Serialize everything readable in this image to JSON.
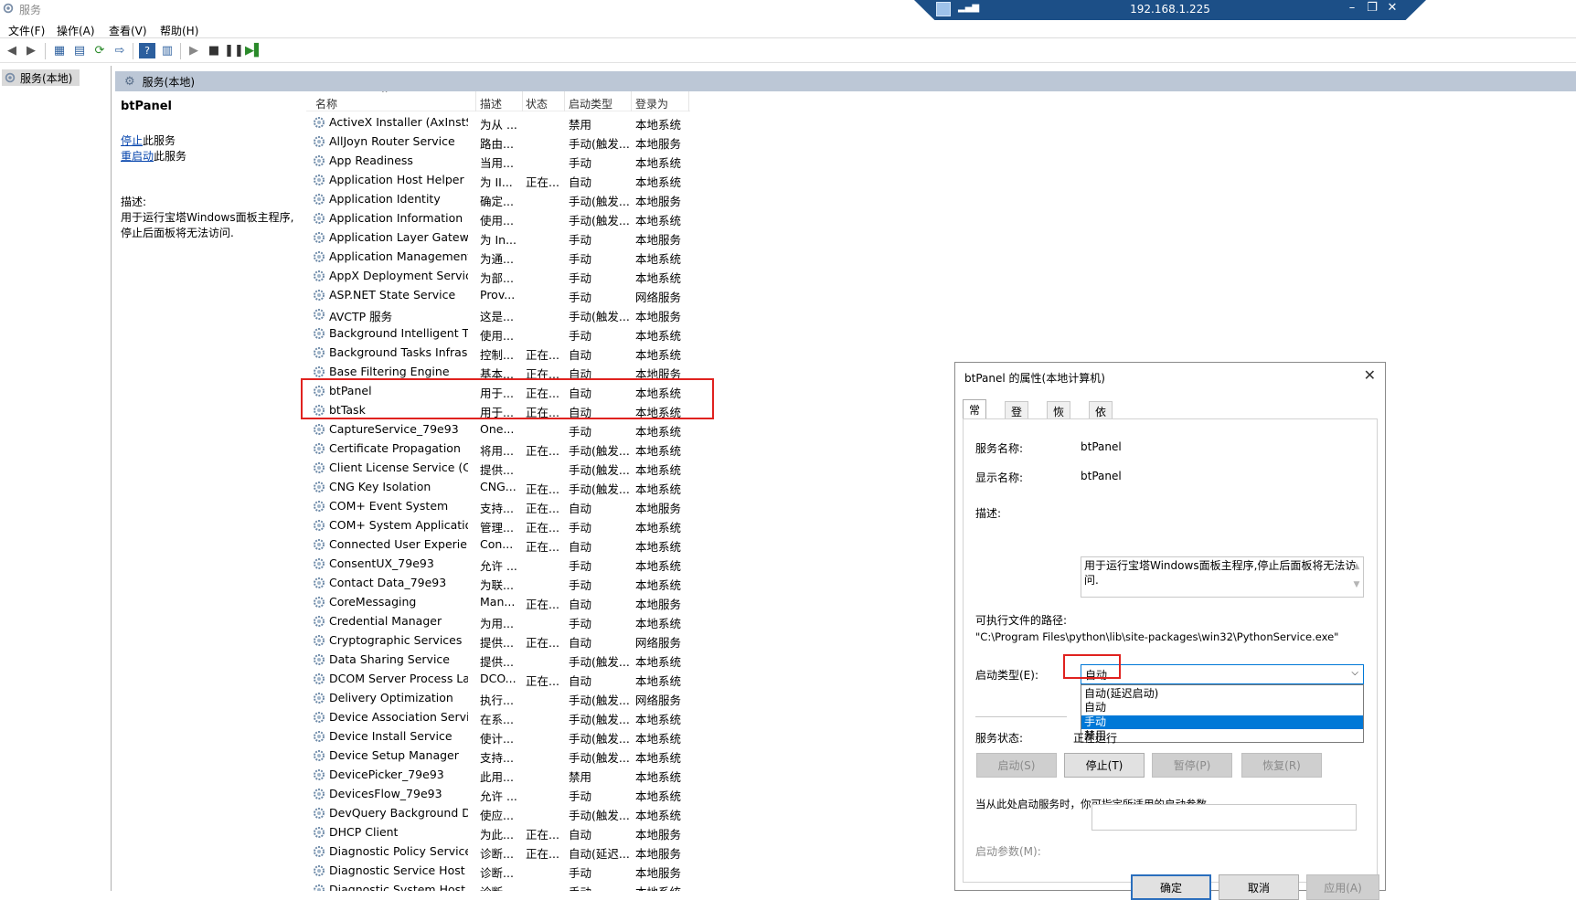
{
  "window": {
    "title": "服务"
  },
  "rdp": {
    "ip": "192.168.1.225",
    "minimize": "–",
    "restore": "❐",
    "close": "✕"
  },
  "menu": [
    "文件(F)",
    "操作(A)",
    "查看(V)",
    "帮助(H)"
  ],
  "tree": {
    "root": "服务(本地)"
  },
  "header": {
    "title": "服务(本地)"
  },
  "detail": {
    "name": "btPanel",
    "stop_link": "停止",
    "stop_suffix": "此服务",
    "restart_link": "重启动",
    "restart_suffix": "此服务",
    "desc_label": "描述:",
    "desc_text": "用于运行宝塔Windows面板主程序,停止后面板将无法访问."
  },
  "columns": {
    "name": "名称",
    "desc": "描述",
    "status": "状态",
    "startup": "启动类型",
    "logon": "登录为"
  },
  "services": [
    [
      "ActiveX Installer (AxInstSV)",
      "为从 ...",
      "",
      "禁用",
      "本地系统"
    ],
    [
      "AllJoyn Router Service",
      "路由...",
      "",
      "手动(触发...",
      "本地服务"
    ],
    [
      "App Readiness",
      "当用...",
      "",
      "手动",
      "本地系统"
    ],
    [
      "Application Host Helper ...",
      "为 II...",
      "正在...",
      "自动",
      "本地系统"
    ],
    [
      "Application Identity",
      "确定...",
      "",
      "手动(触发...",
      "本地服务"
    ],
    [
      "Application Information",
      "使用...",
      "",
      "手动(触发...",
      "本地系统"
    ],
    [
      "Application Layer Gatewa...",
      "为 In...",
      "",
      "手动",
      "本地服务"
    ],
    [
      "Application Management",
      "为通...",
      "",
      "手动",
      "本地系统"
    ],
    [
      "AppX Deployment Servic...",
      "为部...",
      "",
      "手动",
      "本地系统"
    ],
    [
      "ASP.NET State Service",
      "Prov...",
      "",
      "手动",
      "网络服务"
    ],
    [
      "AVCTP 服务",
      "这是...",
      "",
      "手动(触发...",
      "本地服务"
    ],
    [
      "Background Intelligent T...",
      "使用...",
      "",
      "手动",
      "本地系统"
    ],
    [
      "Background Tasks Infras...",
      "控制...",
      "正在...",
      "自动",
      "本地系统"
    ],
    [
      "Base Filtering Engine",
      "基本...",
      "正在...",
      "自动",
      "本地服务"
    ],
    [
      "btPanel",
      "用于...",
      "正在...",
      "自动",
      "本地系统"
    ],
    [
      "btTask",
      "用于...",
      "正在...",
      "自动",
      "本地系统"
    ],
    [
      "CaptureService_79e93",
      "One...",
      "",
      "手动",
      "本地系统"
    ],
    [
      "Certificate Propagation",
      "将用...",
      "正在...",
      "手动(触发...",
      "本地系统"
    ],
    [
      "Client License Service (Cli...",
      "提供...",
      "",
      "手动(触发...",
      "本地系统"
    ],
    [
      "CNG Key Isolation",
      "CNG...",
      "正在...",
      "手动(触发...",
      "本地系统"
    ],
    [
      "COM+ Event System",
      "支持...",
      "正在...",
      "自动",
      "本地服务"
    ],
    [
      "COM+ System Application",
      "管理...",
      "正在...",
      "手动",
      "本地系统"
    ],
    [
      "Connected User Experien...",
      "Con...",
      "正在...",
      "自动",
      "本地系统"
    ],
    [
      "ConsentUX_79e93",
      "允许 ...",
      "",
      "手动",
      "本地系统"
    ],
    [
      "Contact Data_79e93",
      "为联...",
      "",
      "手动",
      "本地系统"
    ],
    [
      "CoreMessaging",
      "Man...",
      "正在...",
      "自动",
      "本地服务"
    ],
    [
      "Credential Manager",
      "为用...",
      "",
      "手动",
      "本地系统"
    ],
    [
      "Cryptographic Services",
      "提供...",
      "正在...",
      "自动",
      "网络服务"
    ],
    [
      "Data Sharing Service",
      "提供...",
      "",
      "手动(触发...",
      "本地系统"
    ],
    [
      "DCOM Server Process La...",
      "DCO...",
      "正在...",
      "自动",
      "本地系统"
    ],
    [
      "Delivery Optimization",
      "执行...",
      "",
      "手动(触发...",
      "网络服务"
    ],
    [
      "Device Association Service",
      "在系...",
      "",
      "手动(触发...",
      "本地系统"
    ],
    [
      "Device Install Service",
      "使计...",
      "",
      "手动(触发...",
      "本地系统"
    ],
    [
      "Device Setup Manager",
      "支持...",
      "",
      "手动(触发...",
      "本地系统"
    ],
    [
      "DevicePicker_79e93",
      "此用...",
      "",
      "禁用",
      "本地系统"
    ],
    [
      "DevicesFlow_79e93",
      "允许 ...",
      "",
      "手动",
      "本地系统"
    ],
    [
      "DevQuery Background D...",
      "使应...",
      "",
      "手动(触发...",
      "本地系统"
    ],
    [
      "DHCP Client",
      "为此...",
      "正在...",
      "自动",
      "本地服务"
    ],
    [
      "Diagnostic Policy Service",
      "诊断...",
      "正在...",
      "自动(延迟...",
      "本地服务"
    ],
    [
      "Diagnostic Service Host",
      "诊断...",
      "",
      "手动",
      "本地服务"
    ],
    [
      "Diagnostic System Host",
      "诊断...",
      "",
      "手动",
      "本地系统"
    ]
  ],
  "dialog": {
    "title": "btPanel 的属性(本地计算机)",
    "tabs": [
      "常规",
      "登录",
      "恢复",
      "依存关系"
    ],
    "svc_name_label": "服务名称:",
    "svc_name": "btPanel",
    "display_name_label": "显示名称:",
    "display_name": "btPanel",
    "desc_label": "描述:",
    "desc": "用于运行宝塔Windows面板主程序,停止后面板将无法访问.",
    "path_label": "可执行文件的路径:",
    "path": "\"C:\\Program Files\\python\\lib\\site-packages\\win32\\PythonService.exe\"",
    "startup_label": "启动类型(E):",
    "startup_value": "自动",
    "startup_options": [
      "自动(延迟启动)",
      "自动",
      "手动",
      "禁用"
    ],
    "startup_selected": 2,
    "status_label": "服务状态:",
    "status_value": "正在运行",
    "btn_start": "启动(S)",
    "btn_stop": "停止(T)",
    "btn_pause": "暂停(P)",
    "btn_resume": "恢复(R)",
    "hint": "当从此处启动服务时，你可指定所适用的启动参数。",
    "param_label": "启动参数(M):",
    "btn_ok": "确定",
    "btn_cancel": "取消",
    "btn_apply": "应用(A)"
  }
}
